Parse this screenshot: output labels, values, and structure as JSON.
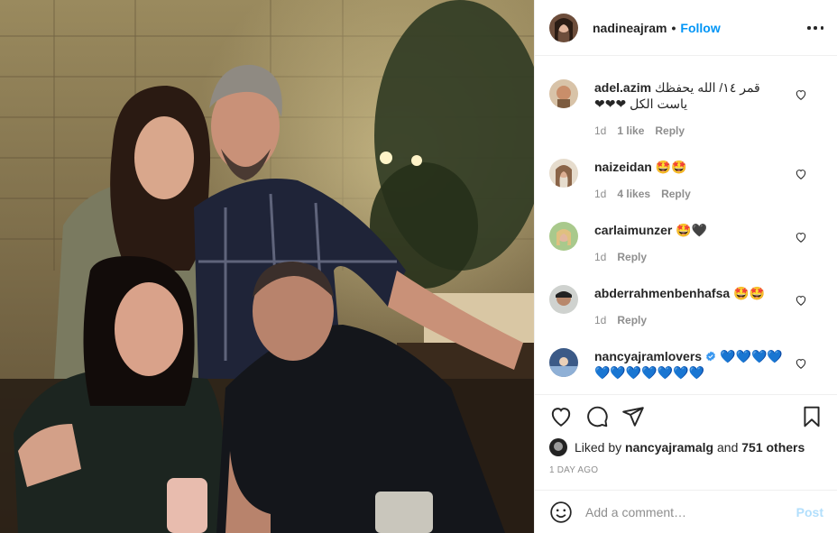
{
  "post": {
    "username": "nadineajram",
    "follow_label": "Follow",
    "separator": "•",
    "photo_alt": "Four people posing at a restaurant table"
  },
  "comments": [
    {
      "username": "adel.azim",
      "text": "قمر ١٤/ الله يحفظك ياست الكل ❤❤❤",
      "time": "1d",
      "likes": "1 like",
      "reply": "Reply"
    },
    {
      "username": "naizeidan",
      "text": "🤩🤩",
      "time": "1d",
      "likes": "4 likes",
      "reply": "Reply"
    },
    {
      "username": "carlaimunzer",
      "text": "🤩🖤",
      "time": "1d",
      "likes": "",
      "reply": "Reply"
    },
    {
      "username": "abderrahmenbenhafsa",
      "text": "🤩🤩",
      "time": "1d",
      "likes": "",
      "reply": "Reply"
    },
    {
      "username": "nancyajramlovers",
      "verified": true,
      "text": "💙💙💙💙💙💙💙💙💙💙💙",
      "time": "",
      "likes": "",
      "reply": ""
    }
  ],
  "likes": {
    "prefix": "Liked by",
    "user": "nancyajramalg",
    "middle": "and",
    "others": "751 others"
  },
  "time_ago": "1 day ago",
  "add_comment": {
    "placeholder": "Add a comment…",
    "post_label": "Post"
  },
  "colors": {
    "link_blue": "#0095f6",
    "post_disabled": "#b2dffc",
    "muted": "#8e8e8e",
    "heart_red": "#ed4956"
  },
  "icons": [
    "more-icon",
    "heart-icon",
    "comment-icon",
    "share-icon",
    "bookmark-icon",
    "emoji-icon",
    "verified-icon"
  ]
}
